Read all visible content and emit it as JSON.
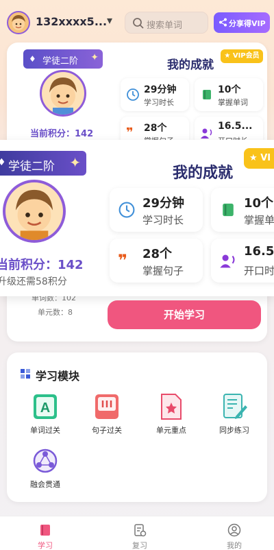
{
  "header": {
    "user_id": "132xxxx5...",
    "search_placeholder": "搜索单词",
    "share_label": "分享得VIP"
  },
  "profile": {
    "level": "学徒二阶",
    "points_label": "当前积分：",
    "points_value": "142",
    "points_large": "当前积分：142",
    "upgrade_text": "升级还需58积分",
    "stat_line_1": "单词数：102",
    "stat_line_2": "单元数：8"
  },
  "achievements": {
    "title": "我的成就",
    "vip_badge": "VIP会员",
    "vip_badge_cut": "VI",
    "tiles": [
      {
        "value": "29分钟",
        "label": "学习时长",
        "icon": "clock-icon"
      },
      {
        "value": "10个",
        "label": "掌握单词",
        "icon": "book-icon"
      },
      {
        "value": "28个",
        "label": "掌握句子",
        "icon": "quote-icon"
      },
      {
        "value": "16.5...",
        "label": "开口时长",
        "icon": "speaker-icon"
      }
    ],
    "tiles_large": [
      {
        "value": "29分钟",
        "label": "学习时长"
      },
      {
        "value": "10个",
        "label": "掌握单"
      },
      {
        "value": "28个",
        "label": "掌握句子"
      },
      {
        "value": "16.5",
        "label": "开口时"
      }
    ]
  },
  "start_button": "开始学习",
  "modules": {
    "title": "学习模块",
    "items": [
      {
        "label": "单词过关",
        "icon": "word-a-icon"
      },
      {
        "label": "句子过关",
        "icon": "sentence-icon"
      },
      {
        "label": "单元重点",
        "icon": "star-doc-icon"
      },
      {
        "label": "同步练习",
        "icon": "pencil-doc-icon"
      },
      {
        "label": "融会贯通",
        "icon": "connect-icon"
      }
    ]
  },
  "nav": {
    "items": [
      {
        "label": "学习",
        "icon": "book-icon",
        "active": true
      },
      {
        "label": "复习",
        "icon": "review-icon",
        "active": false
      },
      {
        "label": "我的",
        "icon": "profile-icon",
        "active": false
      }
    ]
  },
  "colors": {
    "accent_purple": "#6a4fc8",
    "pink_button": "#f0567f",
    "vip_gold": "#f9c21a",
    "title_navy": "#2b2d6e"
  }
}
